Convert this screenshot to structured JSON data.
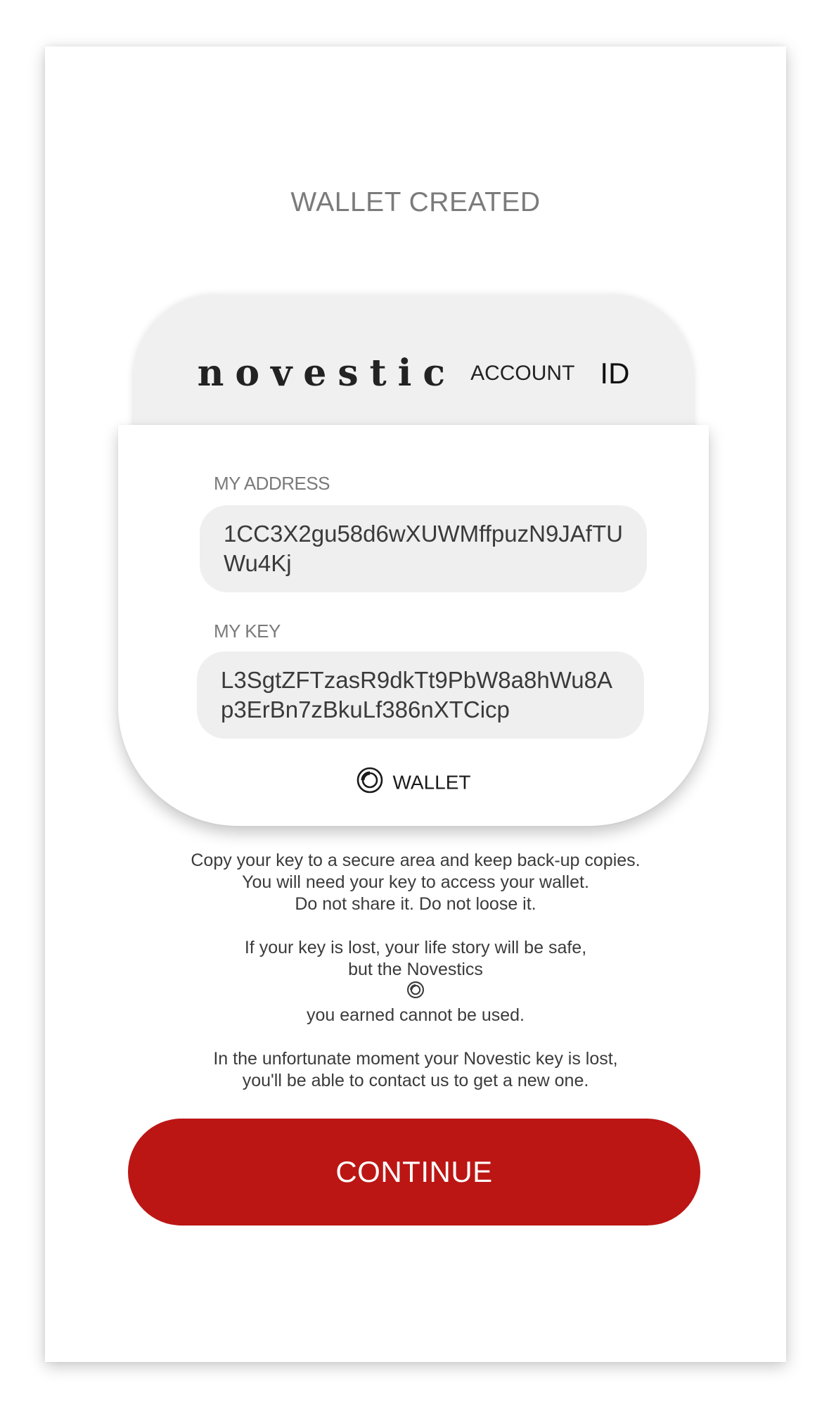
{
  "header": {
    "title": "WALLET CREATED"
  },
  "card": {
    "brand_name": "novestic",
    "account_label": "ACCOUNT",
    "id_label": "ID",
    "address_label": "MY ADDRESS",
    "address_value": "1CC3X2gu58d6wXUWMffpuzN9JAfTUWu4Kj",
    "key_label": "MY KEY",
    "key_value": "L3SgtZFTzasR9dkTt9PbW8a8hWu8Ap3ErBn7zBkuLf386nXTCicp",
    "wallet_label": "WALLET",
    "wallet_icon": "novestics-coin-icon"
  },
  "notes": {
    "p1_l1": "Copy your key to a secure area and keep back-up copies.",
    "p1_l2": "You will need your key to access your wallet.",
    "p1_l3": "Do not share it. Do not loose it.",
    "p2_l1": "If your key is lost, your life story will be safe,",
    "p2_l2_before": "but the Novestics",
    "p2_l2_after": "you earned cannot be used.",
    "p3_l1": "In the unfortunate moment your Novestic key is lost,",
    "p3_l2": "you'll be able to contact us to get a new one."
  },
  "actions": {
    "continue_label": "CONTINUE"
  },
  "colors": {
    "accent": "#bb1614",
    "field_bg": "#efefef",
    "tab_bg": "#f0f0f0"
  }
}
